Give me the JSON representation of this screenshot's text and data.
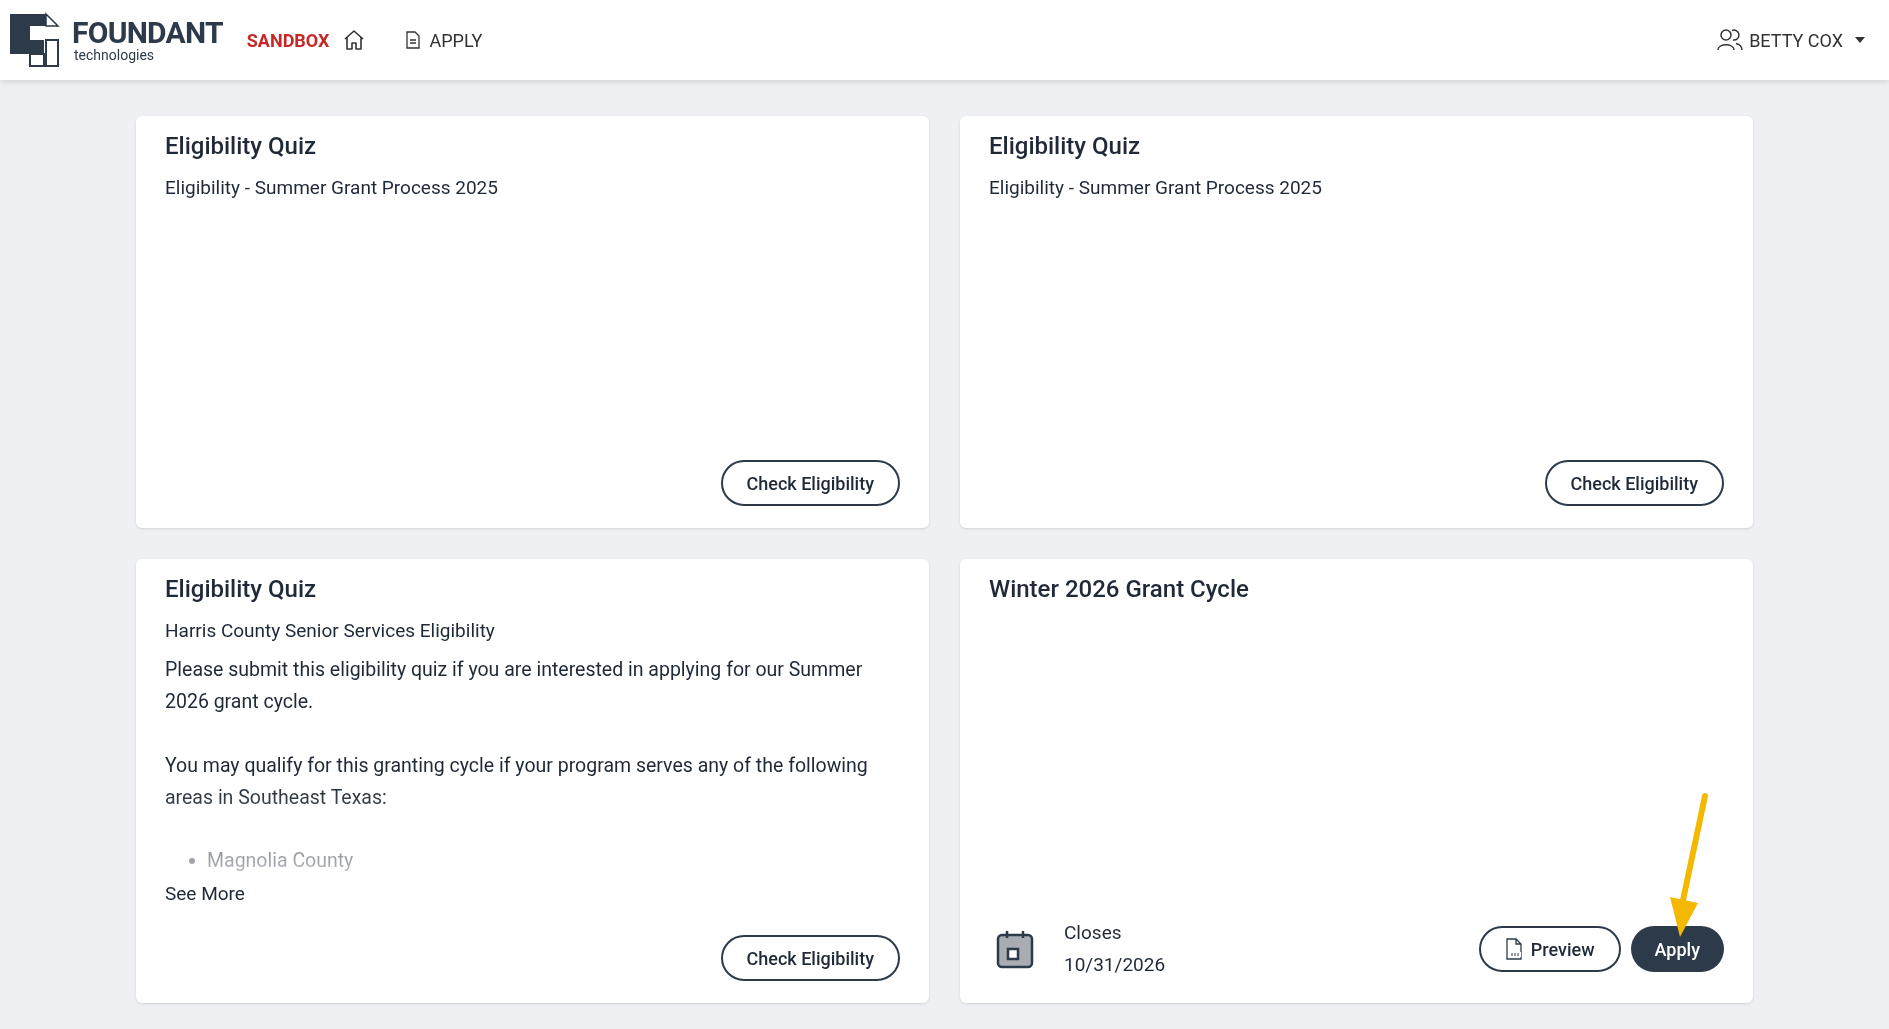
{
  "header": {
    "brand": "FOUNDANT",
    "brand_sub": "technologies",
    "environment": "SANDBOX",
    "nav": [
      {
        "label": "APPLY"
      }
    ],
    "user": "BETTY COX"
  },
  "cards": [
    {
      "kind": "quiz",
      "title": "Eligibility Quiz",
      "subtitle": "Eligibility - Summer Grant Process 2025",
      "button": "Check Eligibility"
    },
    {
      "kind": "quiz",
      "title": "Eligibility Quiz",
      "subtitle": "Eligibility - Summer Grant Process 2025",
      "button": "Check Eligibility"
    },
    {
      "kind": "quiz",
      "title": "Eligibility Quiz",
      "subtitle": "Harris County Senior Services Eligibility",
      "paragraphs": [
        "Please submit this eligibility quiz if you are interested in applying for our Summer 2026 grant cycle.",
        "You may qualify for this granting cycle if your program serves any of the following areas in Southeast Texas:"
      ],
      "list": [
        "Magnolia County"
      ],
      "see_more": "See More",
      "button": "Check Eligibility"
    },
    {
      "kind": "grant",
      "title": "Winter 2026 Grant Cycle",
      "closes_label": "Closes",
      "closes_date": "10/31/2026",
      "preview": "Preview",
      "button": "Apply"
    }
  ]
}
